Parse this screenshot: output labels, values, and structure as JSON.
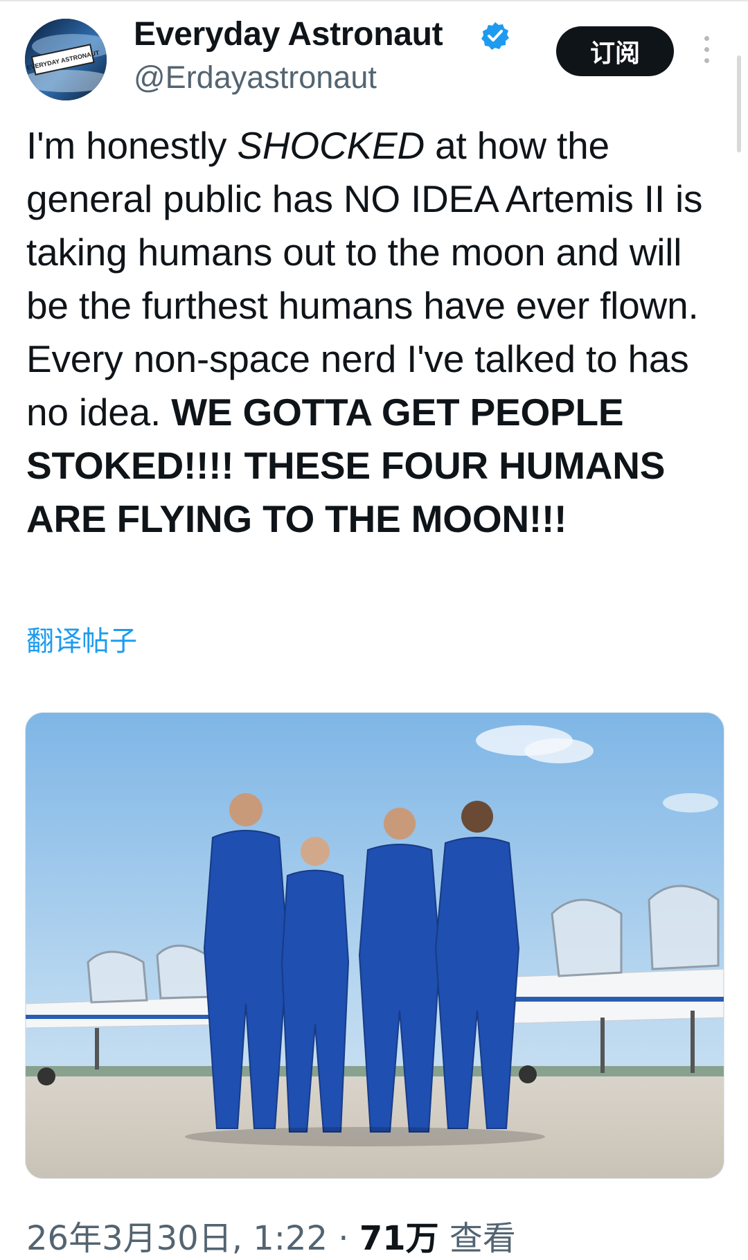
{
  "author": {
    "name": "Everyday Astronaut",
    "handle": "@Erdayastronaut",
    "avatar_logo_text": "EVERYDAY ASTRONAUT",
    "verified_icon": "verified-badge-icon"
  },
  "actions": {
    "subscribe_label": "订阅",
    "more_icon": "more-vertical-icon"
  },
  "tweet": {
    "part1": "I'm honestly ",
    "emphasis": "SHOCKED",
    "part2": " at how the general public has NO IDEA Artemis II is taking humans out to the moon and will be the furthest humans have ever flown. Every non-space nerd I've talked to has no idea. ",
    "caps": "WE GOTTA GET PEOPLE STOKED!!!! THESE FOUR HUMANS ARE FLYING TO THE MOON!!!"
  },
  "translate_label": "翻译帖子",
  "meta": {
    "date_time": "26年3月30日, 1:22",
    "separator": "·",
    "views": "71万",
    "views_label": "查看"
  },
  "colors": {
    "link_blue": "#1d9bf0",
    "verified_blue": "#1d9bf0",
    "text_primary": "#0f1419",
    "text_secondary": "#536471",
    "flight_suit_blue": "#1f4fb0"
  }
}
